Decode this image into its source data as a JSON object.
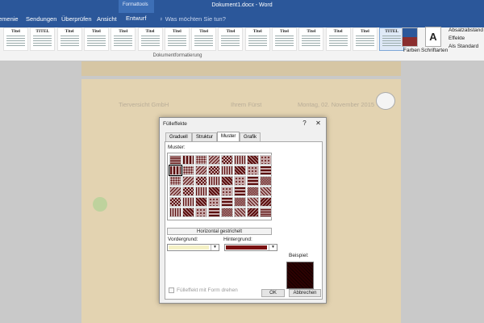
{
  "window": {
    "title": "Dokument1.docx - Word"
  },
  "ribbon_tabs": [
    {
      "label": "Entwurf",
      "active": false
    },
    {
      "label": "Sendungen",
      "active": false
    },
    {
      "label": "Überprüfen",
      "active": false
    },
    {
      "label": "Ansicht",
      "active": false
    },
    {
      "label": "Entwurf",
      "active": true
    }
  ],
  "first_tab_fragment": "emenie",
  "context_tools": {
    "label": "Formattools"
  },
  "search": {
    "placeholder": "Was möchten Sie tun?"
  },
  "ribbon": {
    "group_label": "Dokumentformatierung",
    "style_titles": [
      "Titel",
      "TITEL",
      "Titel",
      "Titel",
      "Titel",
      "Titel",
      "Titel",
      "Titel",
      "Titel",
      "Titel",
      "Titel",
      "Titel",
      "Titel",
      "Titel",
      "TITEL"
    ],
    "colors_label": "Farben",
    "fonts_label": "Schriftarten",
    "paragraph_spacing": "Absatzabstand",
    "effects": "Effekte",
    "set_default": "Als Standard"
  },
  "document": {
    "header_company": "Tierversicht GmbH",
    "header_city": "Ihrem Fürst",
    "header_date": "Montag, 02. November 2015"
  },
  "dialog": {
    "title": "Fülleffekte",
    "help_icon": "?",
    "close_icon": "✕",
    "tabs": [
      {
        "label": "Graduell",
        "active": false
      },
      {
        "label": "Struktur",
        "active": false
      },
      {
        "label": "Muster",
        "active": true
      },
      {
        "label": "Grafik",
        "active": false
      }
    ],
    "pattern_label": "Muster:",
    "selected_pattern": "Horizontal gestrichelt",
    "foreground_label": "Vordergrund:",
    "background_label": "Hintergrund:",
    "foreground_color": "#f5f1c5",
    "background_color": "#7a1212",
    "sample_label": "Beispiel:",
    "rotate_label": "Fülleffekt mit Form drehen",
    "ok_label": "OK",
    "cancel_label": "Abbrechen"
  },
  "colors": {
    "accent": "#2b579a",
    "pattern_fg": "#5a0d0d",
    "pattern_bg": "#c7a9a9"
  }
}
